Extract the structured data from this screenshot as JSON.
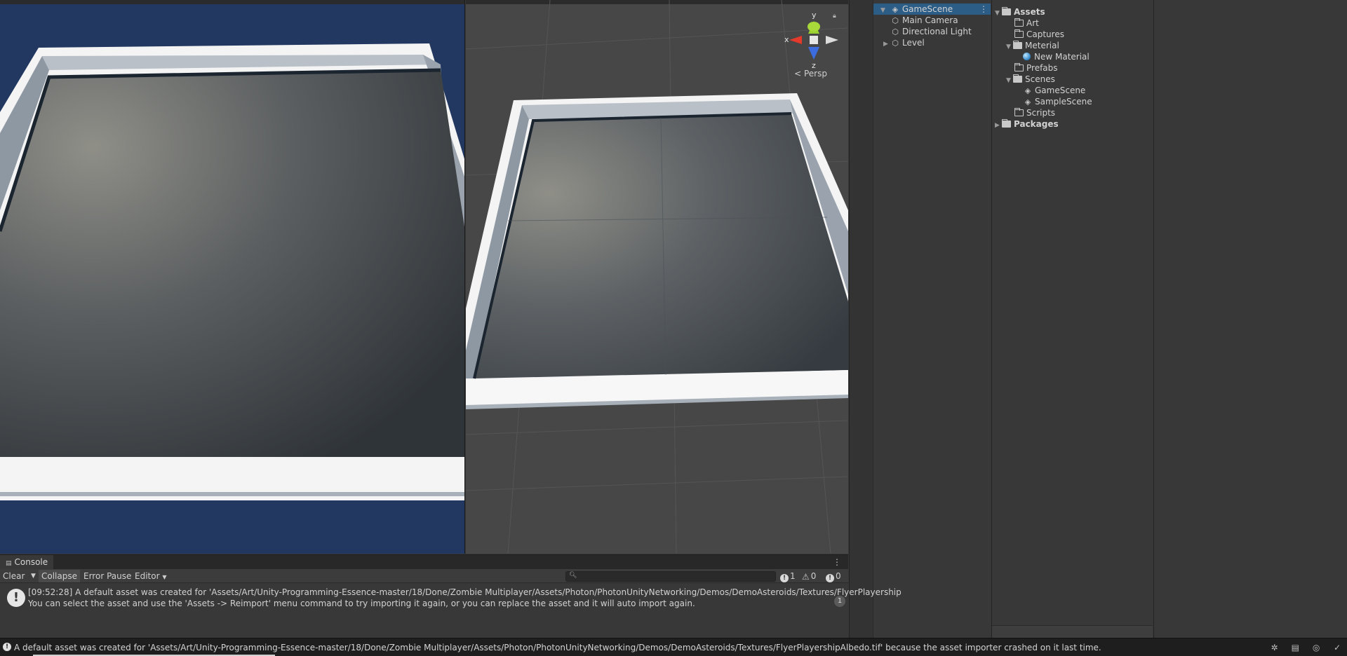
{
  "hierarchy": {
    "scene_name": "GameScene",
    "items": [
      {
        "label": "Main Camera",
        "icon": "gameobject-cube-icon"
      },
      {
        "label": "Directional Light",
        "icon": "gameobject-cube-icon"
      },
      {
        "label": "Level",
        "icon": "gameobject-cube-icon",
        "collapsed": true
      }
    ]
  },
  "project": {
    "root": "Assets",
    "folders": [
      {
        "label": "Art"
      },
      {
        "label": "Captures"
      },
      {
        "label": "Meterial",
        "expanded": true,
        "children": [
          {
            "label": "New Material",
            "icon": "material-sphere-icon"
          }
        ]
      },
      {
        "label": "Prefabs"
      },
      {
        "label": "Scenes",
        "expanded": true,
        "children": [
          {
            "label": "GameScene",
            "icon": "scene-icon"
          },
          {
            "label": "SampleScene",
            "icon": "scene-icon"
          }
        ]
      },
      {
        "label": "Scripts"
      }
    ],
    "packages": "Packages"
  },
  "scene_view": {
    "axis_x": "x",
    "axis_y": "y",
    "axis_z": "z",
    "projection": "< Persp"
  },
  "console": {
    "tab_label": "Console",
    "toolbar": {
      "clear": "Clear",
      "collapse": "Collapse",
      "error_pause": "Error Pause",
      "editor": "Editor"
    },
    "counts": {
      "errors": "1",
      "warnings": "0",
      "logs": "0"
    },
    "entry": {
      "line1": "[09:52:28] A default asset was created for 'Assets/Art/Unity-Programming-Essence-master/18/Done/Zombie Multiplayer/Assets/Photon/PhotonUnityNetworking/Demos/DemoAsteroids/Textures/FlyerPlayership",
      "line2": "You can select the asset and use the 'Assets -> Reimport' menu command to try importing it again, or you can replace the asset and it will auto import again.",
      "count": "1"
    }
  },
  "statusbar": {
    "message": "A default asset was created for 'Assets/Art/Unity-Programming-Essence-master/18/Done/Zombie Multiplayer/Assets/Photon/PhotonUnityNetworking/Demos/DemoAsteroids/Textures/FlyerPlayershipAlbedo.tif' because the asset importer crashed on it last time."
  },
  "colors": {
    "game_background": "#223860",
    "scene_background": "#474747",
    "selection": "#2c5d87",
    "panel": "#383838"
  }
}
